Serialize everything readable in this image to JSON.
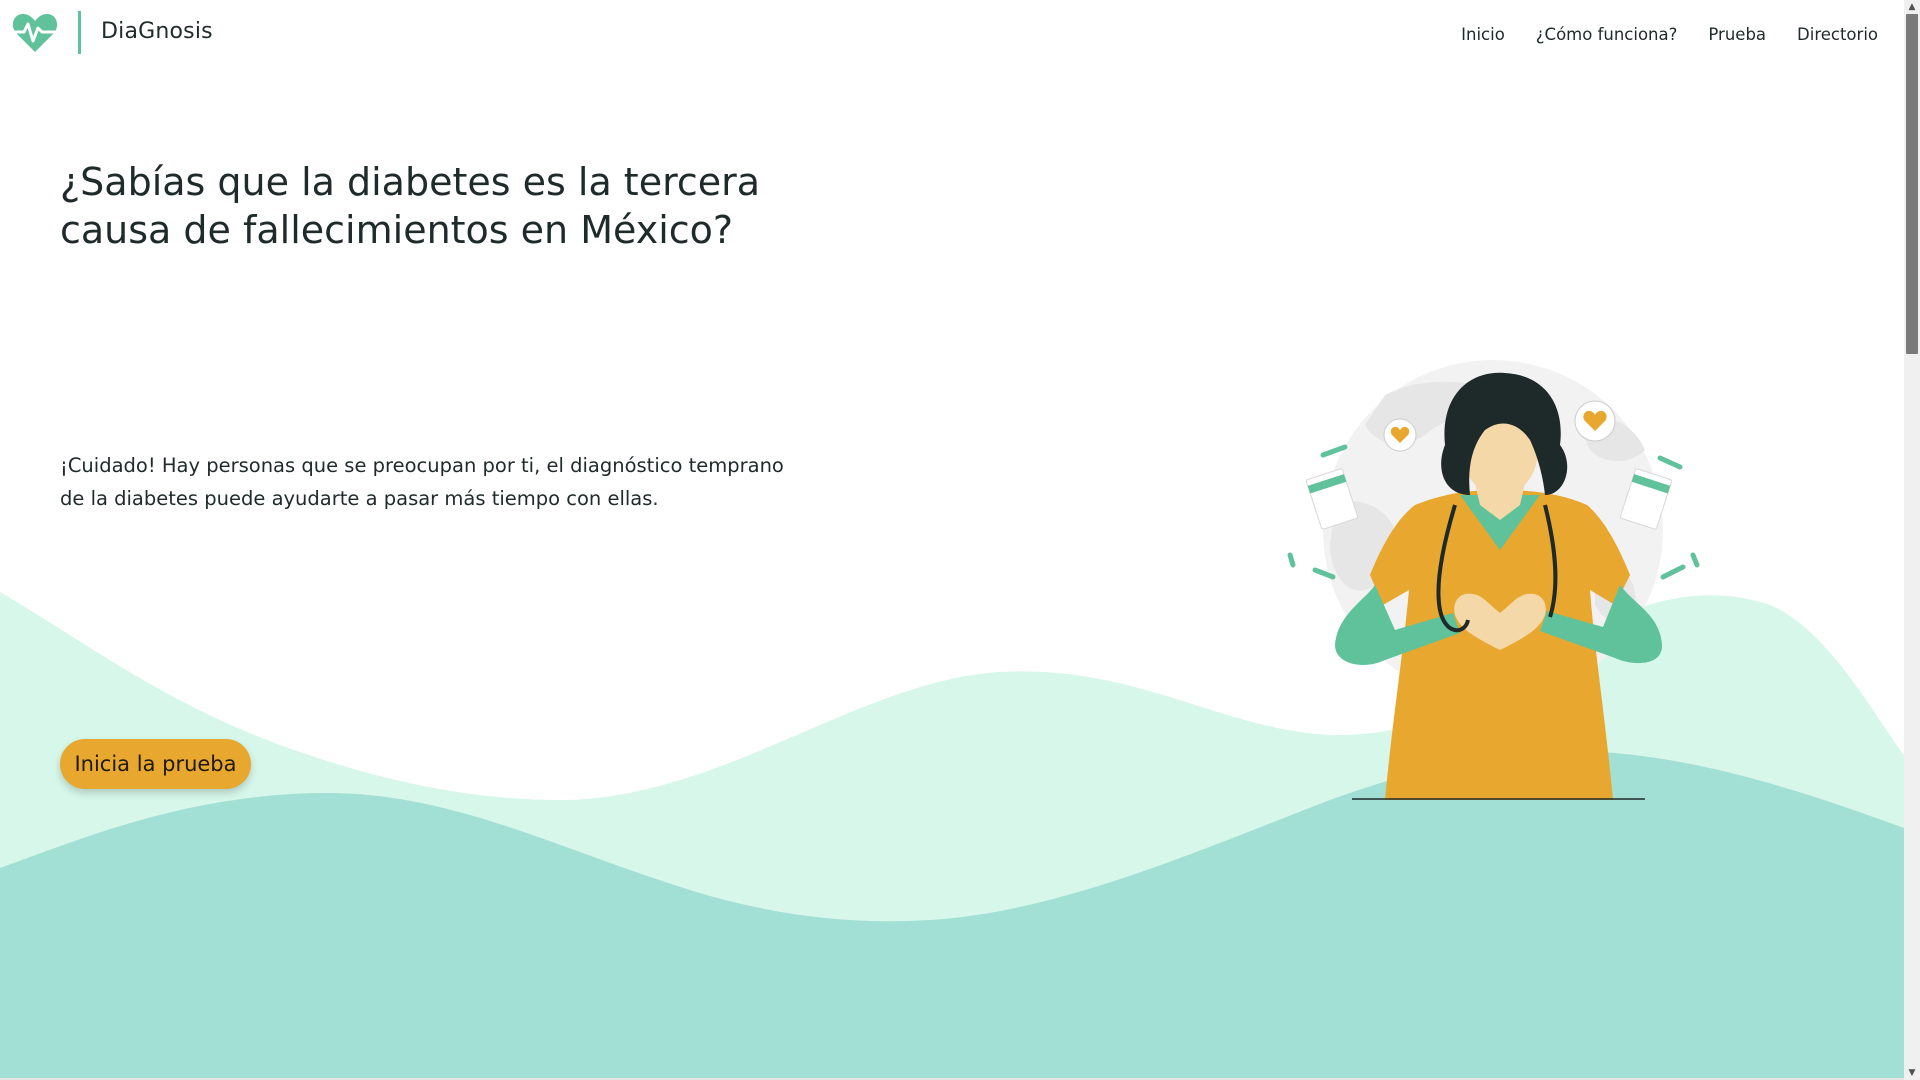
{
  "colors": {
    "accent_green": "#5fc29b",
    "wave_light": "#d6f7ea",
    "wave_dark": "#a2dfd4",
    "cta_orange": "#e8a72e",
    "text_dark": "#1f2a2a"
  },
  "header": {
    "logo_icon": "heart-pulse-icon",
    "brand": "DiaGnosis",
    "nav": [
      {
        "label": "Inicio"
      },
      {
        "label": "¿Cómo funciona?"
      },
      {
        "label": "Prueba"
      },
      {
        "label": "Directorio"
      }
    ]
  },
  "hero": {
    "title": "¿Sabías que la diabetes es la tercera causa de fallecimientos en México?",
    "text": "¡Cuidado! Hay personas que se preocupan por ti, el diagnóstico temprano de la diabetes puede ayudarte a pasar más tiempo con ellas.",
    "cta_label": "Inicia la prueba",
    "illustration": "doctor-heart-hands-illustration"
  }
}
